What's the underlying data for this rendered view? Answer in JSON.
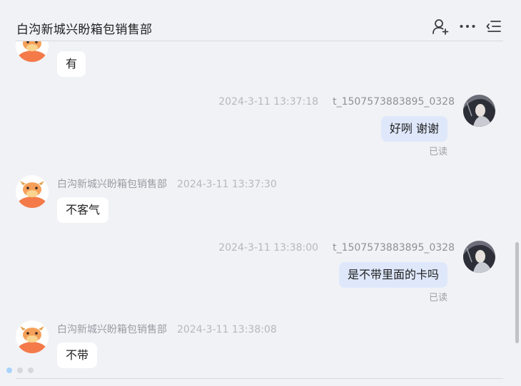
{
  "header": {
    "title": "白沟新城兴盼箱包销售部",
    "icons": [
      "add-member-icon",
      "more-icon",
      "menu-icon"
    ]
  },
  "messages": [
    {
      "id": "m0",
      "direction": "in",
      "text": "有"
    },
    {
      "id": "m1",
      "direction": "out",
      "sender": "t_1507573883895_0328",
      "time": "2024-3-11 13:37:18",
      "text": "好咧 谢谢",
      "status": "已读"
    },
    {
      "id": "m2",
      "direction": "in",
      "sender": "白沟新城兴盼箱包销售部",
      "time": "2024-3-11 13:37:30",
      "text": "不客气"
    },
    {
      "id": "m3",
      "direction": "out",
      "sender": "t_1507573883895_0328",
      "time": "2024-3-11 13:38:00",
      "text": "是不带里面的卡吗",
      "status": "已读"
    },
    {
      "id": "m4",
      "direction": "in",
      "sender": "白沟新城兴盼箱包销售部",
      "time": "2024-3-11 13:38:08",
      "text": "不带"
    }
  ],
  "colors": {
    "background": "#f1f2f6",
    "bubble_in": "#ffffff",
    "bubble_out": "#dfe8fb",
    "avatar_orange": "#f47a4a",
    "loading_dot_active": "#a9d3fb"
  }
}
